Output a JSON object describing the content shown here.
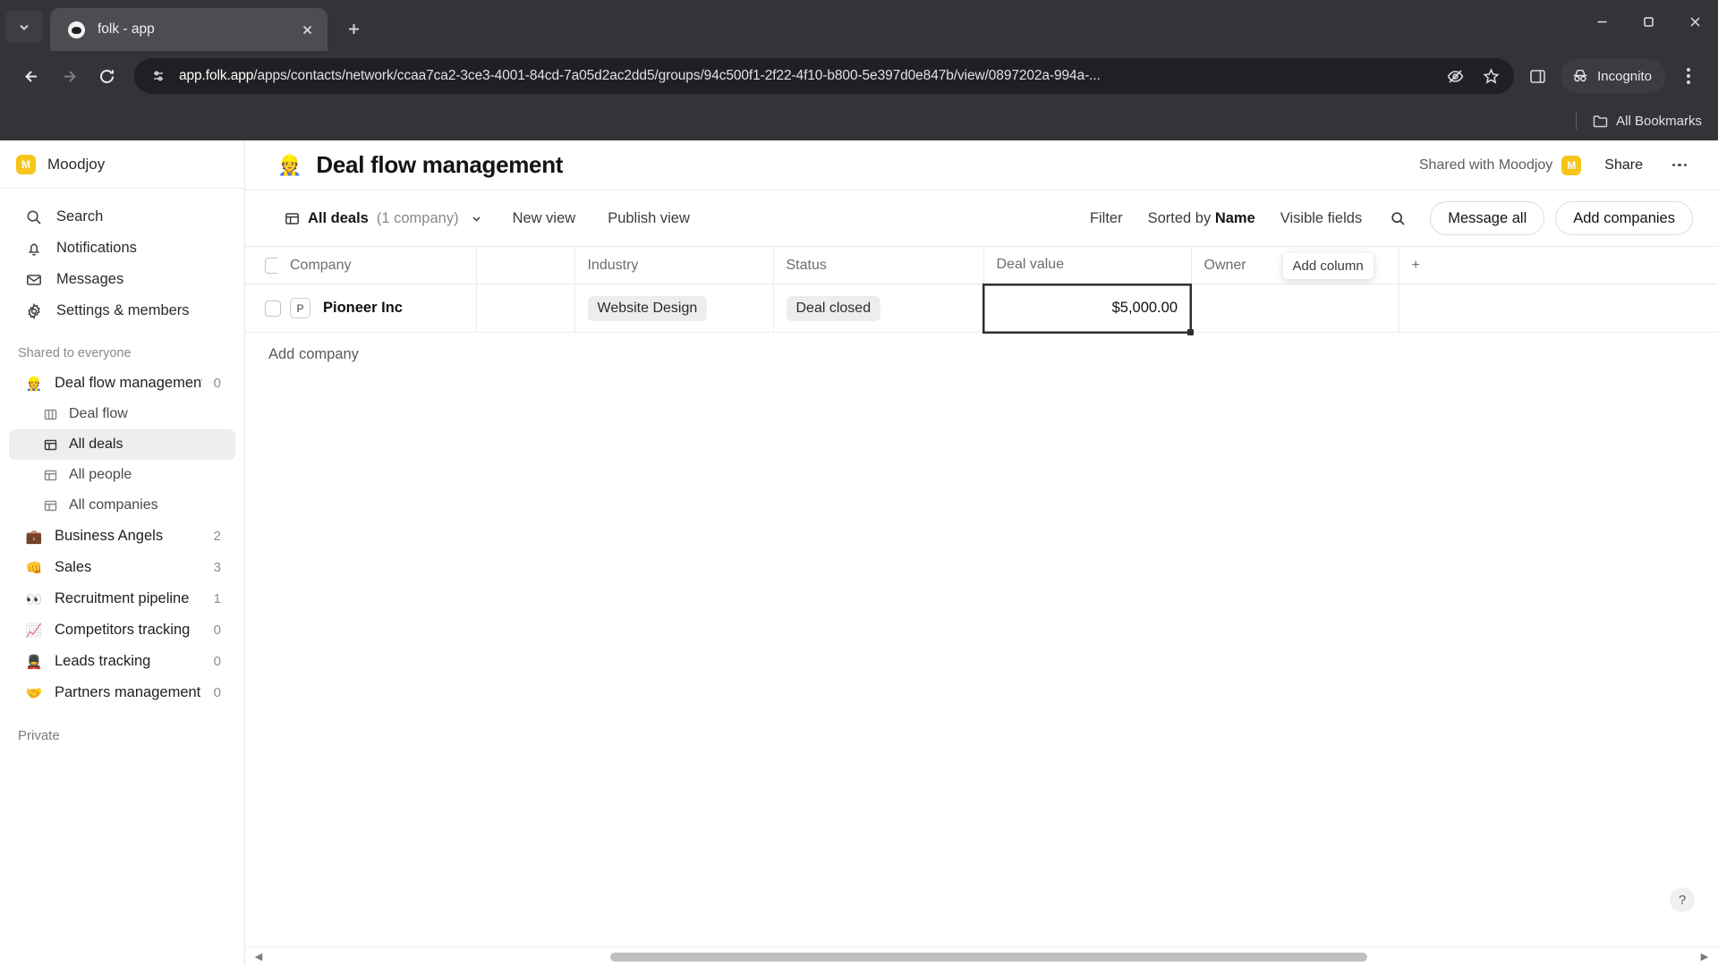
{
  "browser": {
    "tab": {
      "title": "folk - app",
      "favicon": "folk-favicon"
    },
    "url_prefix": "app.folk.app",
    "url_rest": "/apps/contacts/network/ccaa7ca2-3ce3-4001-84cd-7a05d2ac2dd5/groups/94c500f1-2f22-4f10-b800-5e397d0e847b/view/0897202a-994a-...",
    "incognito_label": "Incognito",
    "bookmarks_label": "All Bookmarks"
  },
  "sidebar": {
    "workspace": {
      "badge": "M",
      "name": "Moodjoy"
    },
    "nav": [
      {
        "label": "Search",
        "icon": "search-icon"
      },
      {
        "label": "Notifications",
        "icon": "bell-icon"
      },
      {
        "label": "Messages",
        "icon": "envelope-icon"
      },
      {
        "label": "Settings & members",
        "icon": "gear-icon"
      }
    ],
    "shared_section_label": "Shared to everyone",
    "groups": [
      {
        "label": "Deal flow management",
        "emoji": "👷",
        "count": "0"
      },
      {
        "label": "Business Angels",
        "emoji": "💼",
        "count": "2"
      },
      {
        "label": "Sales",
        "emoji": "👊",
        "count": "3"
      },
      {
        "label": "Recruitment pipeline",
        "emoji": "👀",
        "count": "1"
      },
      {
        "label": "Competitors tracking",
        "emoji": "📈",
        "count": "0"
      },
      {
        "label": "Leads tracking",
        "emoji": "💂",
        "count": "0"
      },
      {
        "label": "Partners management",
        "emoji": "🤝",
        "count": "0"
      }
    ],
    "subviews": [
      {
        "label": "Deal flow",
        "icon": "board-icon",
        "active": false
      },
      {
        "label": "All deals",
        "icon": "table-icon",
        "active": true
      },
      {
        "label": "All people",
        "icon": "table-icon",
        "active": false
      },
      {
        "label": "All companies",
        "icon": "table-icon",
        "active": false
      }
    ],
    "private_label": "Private"
  },
  "header": {
    "emoji": "👷",
    "title": "Deal flow management",
    "shared_with": "Shared with Moodjoy",
    "shared_avatar": "M",
    "share_label": "Share"
  },
  "view_bar": {
    "view_name": "All deals",
    "view_count": "(1 company)",
    "new_view": "New view",
    "publish_view": "Publish view",
    "filter": "Filter",
    "sorted_by_prefix": "Sorted by ",
    "sorted_by_value": "Name",
    "visible_fields": "Visible fields",
    "message_all": "Message all",
    "add_companies": "Add companies"
  },
  "table": {
    "columns": [
      "Company",
      "",
      "Industry",
      "Status",
      "Deal value",
      "Owner"
    ],
    "rows": [
      {
        "avatar": "P",
        "company": "Pioneer Inc",
        "blank": "",
        "industry": "Website Design",
        "status": "Deal closed",
        "deal_value": "$5,000.00",
        "owner": ""
      }
    ],
    "add_company_label": "Add company",
    "add_column_tooltip": "Add column",
    "plus_label": "+",
    "help_label": "?"
  }
}
